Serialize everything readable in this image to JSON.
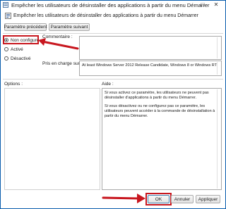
{
  "window": {
    "title": "Empêcher les utilisateurs de désinstaller des applications à partir du menu Démarrer",
    "maximize_glyph": "□",
    "close_glyph": "✕"
  },
  "header": {
    "policy_title": "Empêcher les utilisateurs de désinstaller des applications à partir du menu Démarrer",
    "icon": "policy-settings-icon"
  },
  "nav": {
    "previous_label": "Paramètre précédent",
    "next_label": "Paramètre suivant"
  },
  "options": [
    {
      "label": "Non configuré",
      "checked": true
    },
    {
      "label": "Activé",
      "checked": false
    },
    {
      "label": "Désactivé",
      "checked": false
    }
  ],
  "comment_label": "Commentaire :",
  "support": {
    "label": "Pris en charge sur :",
    "value": "At least Windows Server 2012 Release Candidate, Windows 8 or Windows RT"
  },
  "options_label": "Options :",
  "help_label": "Aide :",
  "help": {
    "para1": "Si vous activez ce paramètre, les utilisateurs ne peuvent pas désinstaller d'applications à partir du menu Démarrer.",
    "para2": "Si vous désactivez ou ne configurez pas ce paramètre, les utilisateurs peuvent accéder à la commande de désinstallation à partir du menu Démarrer."
  },
  "buttons": {
    "ok": "OK",
    "cancel": "Annuler",
    "apply": "Appliquer"
  },
  "colors": {
    "highlight_red": "#c8171f",
    "window_border": "#0a5dad"
  }
}
